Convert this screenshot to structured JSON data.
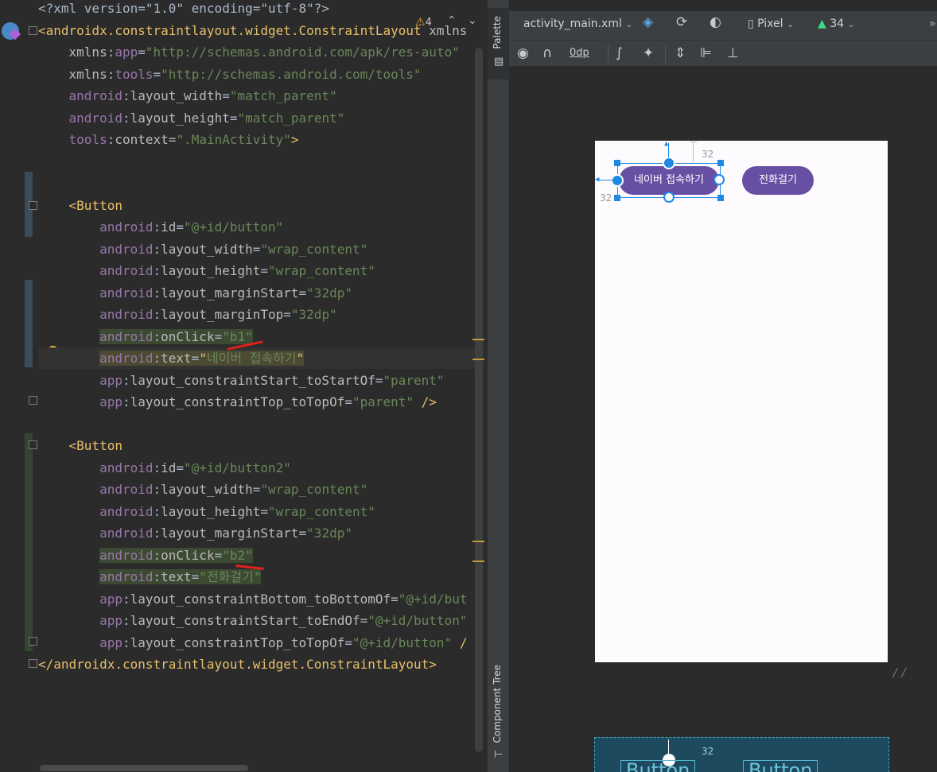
{
  "editor": {
    "lines": [
      {
        "parts": [
          [
            "t-punc",
            "<?xml version=\"1.0\" encoding=\"utf-8\"?>"
          ]
        ]
      },
      {
        "parts": [
          [
            "t-tag",
            "<androidx.constraintlayout.widget.ConstraintLayout"
          ],
          [
            "t-attr",
            " xmlns"
          ]
        ]
      },
      {
        "parts": [
          [
            "t-attr",
            "    xmlns"
          ],
          [
            "t-punc",
            ":"
          ],
          [
            "t-ns",
            "app"
          ],
          [
            "t-punc",
            "="
          ],
          [
            "t-val",
            "\"http://schemas.android.com/apk/res-auto\""
          ]
        ]
      },
      {
        "parts": [
          [
            "t-attr",
            "    xmlns"
          ],
          [
            "t-punc",
            ":"
          ],
          [
            "t-ns",
            "tools"
          ],
          [
            "t-punc",
            "="
          ],
          [
            "t-val",
            "\"http://schemas.android.com/tools\""
          ]
        ]
      },
      {
        "parts": [
          [
            "t-ns",
            "    android"
          ],
          [
            "t-punc",
            ":"
          ],
          [
            "t-attr",
            "layout_width"
          ],
          [
            "t-punc",
            "="
          ],
          [
            "t-val",
            "\"match_parent\""
          ]
        ]
      },
      {
        "parts": [
          [
            "t-ns",
            "    android"
          ],
          [
            "t-punc",
            ":"
          ],
          [
            "t-attr",
            "layout_height"
          ],
          [
            "t-punc",
            "="
          ],
          [
            "t-val",
            "\"match_parent\""
          ]
        ]
      },
      {
        "parts": [
          [
            "t-ns",
            "    tools"
          ],
          [
            "t-punc",
            ":"
          ],
          [
            "t-attr",
            "context"
          ],
          [
            "t-punc",
            "="
          ],
          [
            "t-val",
            "\".MainActivity\""
          ],
          [
            "t-tag",
            ">"
          ]
        ]
      },
      {
        "parts": []
      },
      {
        "parts": []
      },
      {
        "parts": [
          [
            "t-tag",
            "    <Button"
          ]
        ]
      },
      {
        "parts": [
          [
            "t-ns",
            "        android"
          ],
          [
            "t-punc",
            ":"
          ],
          [
            "t-attr",
            "id"
          ],
          [
            "t-punc",
            "="
          ],
          [
            "t-val",
            "\"@+id/button\""
          ]
        ]
      },
      {
        "parts": [
          [
            "t-ns",
            "        android"
          ],
          [
            "t-punc",
            ":"
          ],
          [
            "t-attr",
            "layout_width"
          ],
          [
            "t-punc",
            "="
          ],
          [
            "t-val",
            "\"wrap_content\""
          ]
        ]
      },
      {
        "parts": [
          [
            "t-ns",
            "        android"
          ],
          [
            "t-punc",
            ":"
          ],
          [
            "t-attr",
            "layout_height"
          ],
          [
            "t-punc",
            "="
          ],
          [
            "t-val",
            "\"wrap_content\""
          ]
        ]
      },
      {
        "parts": [
          [
            "t-ns",
            "        android"
          ],
          [
            "t-punc",
            ":"
          ],
          [
            "t-attr",
            "layout_marginStart"
          ],
          [
            "t-punc",
            "="
          ],
          [
            "t-val",
            "\"32dp\""
          ]
        ]
      },
      {
        "parts": [
          [
            "t-ns",
            "        android"
          ],
          [
            "t-punc",
            ":"
          ],
          [
            "t-attr",
            "layout_marginTop"
          ],
          [
            "t-punc",
            "="
          ],
          [
            "t-val",
            "\"32dp\""
          ]
        ]
      },
      {
        "parts": [
          [
            "t-ns",
            "        android"
          ],
          [
            "t-punc",
            ":"
          ],
          [
            "t-attr",
            "onClick"
          ],
          [
            "t-punc",
            "="
          ],
          [
            "t-val",
            "\"b1\""
          ]
        ],
        "hl": "hl"
      },
      {
        "parts": [
          [
            "t-ns",
            "        android"
          ],
          [
            "t-punc",
            ":"
          ],
          [
            "t-attr",
            "text"
          ],
          [
            "t-punc",
            "="
          ],
          [
            "t-tag",
            "\""
          ],
          [
            "t-val",
            "네이버 접속하기"
          ],
          [
            "t-tag",
            "\""
          ]
        ],
        "hl": "hl-warn",
        "caret": true
      },
      {
        "parts": [
          [
            "t-ns",
            "        app"
          ],
          [
            "t-punc",
            ":"
          ],
          [
            "t-attr",
            "layout_constraintStart_toStartOf"
          ],
          [
            "t-punc",
            "="
          ],
          [
            "t-val",
            "\"parent\""
          ]
        ]
      },
      {
        "parts": [
          [
            "t-ns",
            "        app"
          ],
          [
            "t-punc",
            ":"
          ],
          [
            "t-attr",
            "layout_constraintTop_toTopOf"
          ],
          [
            "t-punc",
            "="
          ],
          [
            "t-val",
            "\"parent\""
          ],
          [
            "t-tag",
            " />"
          ]
        ]
      },
      {
        "parts": []
      },
      {
        "parts": [
          [
            "t-tag",
            "    <Button"
          ]
        ]
      },
      {
        "parts": [
          [
            "t-ns",
            "        android"
          ],
          [
            "t-punc",
            ":"
          ],
          [
            "t-attr",
            "id"
          ],
          [
            "t-punc",
            "="
          ],
          [
            "t-val",
            "\"@+id/button2\""
          ]
        ]
      },
      {
        "parts": [
          [
            "t-ns",
            "        android"
          ],
          [
            "t-punc",
            ":"
          ],
          [
            "t-attr",
            "layout_width"
          ],
          [
            "t-punc",
            "="
          ],
          [
            "t-val",
            "\"wrap_content\""
          ]
        ]
      },
      {
        "parts": [
          [
            "t-ns",
            "        android"
          ],
          [
            "t-punc",
            ":"
          ],
          [
            "t-attr",
            "layout_height"
          ],
          [
            "t-punc",
            "="
          ],
          [
            "t-val",
            "\"wrap_content\""
          ]
        ]
      },
      {
        "parts": [
          [
            "t-ns",
            "        android"
          ],
          [
            "t-punc",
            ":"
          ],
          [
            "t-attr",
            "layout_marginStart"
          ],
          [
            "t-punc",
            "="
          ],
          [
            "t-val",
            "\"32dp\""
          ]
        ]
      },
      {
        "parts": [
          [
            "t-ns",
            "        android"
          ],
          [
            "t-punc",
            ":"
          ],
          [
            "t-attr",
            "onClick"
          ],
          [
            "t-punc",
            "="
          ],
          [
            "t-val",
            "\"b2\""
          ]
        ],
        "hl": "hl"
      },
      {
        "parts": [
          [
            "t-ns",
            "        android"
          ],
          [
            "t-punc",
            ":"
          ],
          [
            "t-attr",
            "text"
          ],
          [
            "t-punc",
            "="
          ],
          [
            "t-val",
            "\"전화걸기\""
          ]
        ],
        "hl": "hl"
      },
      {
        "parts": [
          [
            "t-ns",
            "        app"
          ],
          [
            "t-punc",
            ":"
          ],
          [
            "t-attr",
            "layout_constraintBottom_toBottomOf"
          ],
          [
            "t-punc",
            "="
          ],
          [
            "t-val",
            "\"@+id/but"
          ]
        ]
      },
      {
        "parts": [
          [
            "t-ns",
            "        app"
          ],
          [
            "t-punc",
            ":"
          ],
          [
            "t-attr",
            "layout_constraintStart_toEndOf"
          ],
          [
            "t-punc",
            "="
          ],
          [
            "t-val",
            "\"@+id/button\""
          ]
        ]
      },
      {
        "parts": [
          [
            "t-ns",
            "        app"
          ],
          [
            "t-punc",
            ":"
          ],
          [
            "t-attr",
            "layout_constraintTop_toTopOf"
          ],
          [
            "t-punc",
            "="
          ],
          [
            "t-val",
            "\"@+id/button\""
          ],
          [
            "t-tag",
            " /"
          ]
        ]
      },
      {
        "parts": [
          [
            "t-tag",
            "</androidx.constraintlayout.widget.ConstraintLayout>"
          ]
        ]
      }
    ],
    "warning_count": "4"
  },
  "side_tabs": {
    "palette": "Palette",
    "component_tree": "Component Tree"
  },
  "design_toolbar": {
    "file": "activity_main.xml",
    "device": "Pixel",
    "api": "34",
    "margin": "0dp"
  },
  "preview": {
    "button1_text": "네이버 접속하기",
    "button2_text": "전화걸기",
    "margin_top_label": "32",
    "margin_start_label": "32",
    "blueprint_label": "32",
    "blueprint_button1": "Button",
    "blueprint_button2": "Button"
  },
  "colors": {
    "button": "#6750a4",
    "selection": "#1e88e5",
    "canvas": "#fefbff"
  }
}
